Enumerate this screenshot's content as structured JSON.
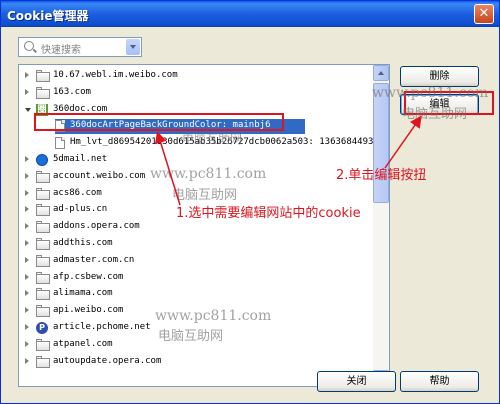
{
  "window": {
    "title": "Cookie管理器",
    "close_glyph": "✕"
  },
  "search": {
    "placeholder": "快速搜索"
  },
  "tree": {
    "items": [
      {
        "label": "10.67.webl.im.weibo.com",
        "level": 0,
        "icon": "folder-icon",
        "expanded": false
      },
      {
        "label": "163.com",
        "level": 0,
        "icon": "folder-icon",
        "expanded": false
      },
      {
        "label": "360doc.com",
        "level": 0,
        "icon": "360doc-favicon-icon",
        "expanded": true,
        "favicon_text": "圈"
      },
      {
        "label": "360docArtPageBackGroundColor: mainbj6",
        "level": 1,
        "icon": "file-icon",
        "selected": true
      },
      {
        "label": "Hm_lvt_d86954201130d615ab35b26727dcb0062a503: 1363684493",
        "level": 1,
        "icon": "file-icon"
      },
      {
        "label": "5dmail.net",
        "level": 0,
        "icon": "5dmail-favicon-icon",
        "expanded": false
      },
      {
        "label": "account.weibo.com",
        "level": 0,
        "icon": "folder-icon",
        "expanded": false
      },
      {
        "label": "acs86.com",
        "level": 0,
        "icon": "folder-icon",
        "expanded": false
      },
      {
        "label": "ad-plus.cn",
        "level": 0,
        "icon": "folder-icon",
        "expanded": false
      },
      {
        "label": "addons.opera.com",
        "level": 0,
        "icon": "folder-icon",
        "expanded": false
      },
      {
        "label": "addthis.com",
        "level": 0,
        "icon": "folder-icon",
        "expanded": false
      },
      {
        "label": "admaster.com.cn",
        "level": 0,
        "icon": "folder-icon",
        "expanded": false
      },
      {
        "label": "afp.csbew.com",
        "level": 0,
        "icon": "folder-icon",
        "expanded": false
      },
      {
        "label": "alimama.com",
        "level": 0,
        "icon": "folder-icon",
        "expanded": false
      },
      {
        "label": "api.weibo.com",
        "level": 0,
        "icon": "folder-icon",
        "expanded": false
      },
      {
        "label": "article.pchome.net",
        "level": 0,
        "icon": "pchome-favicon-icon",
        "expanded": false,
        "favicon_text": "P"
      },
      {
        "label": "atpanel.com",
        "level": 0,
        "icon": "folder-icon",
        "expanded": false
      },
      {
        "label": "autoupdate.opera.com",
        "level": 0,
        "icon": "folder-icon",
        "expanded": false
      }
    ]
  },
  "buttons": {
    "delete": "删除",
    "edit": "编辑",
    "close": "关闭",
    "help": "帮助"
  },
  "annotations": {
    "step1": "1.选中需要编辑网站中的cookie",
    "step2": "2.单击编辑按扭"
  },
  "watermarks": [
    {
      "text": "www.pc811.com",
      "name": "watermark-url-top"
    },
    {
      "text": "电脑互助网",
      "name": "watermark-cn-top"
    },
    {
      "text": "www.pc811.com",
      "name": "watermark-url-mid"
    },
    {
      "text": "电脑互助网",
      "name": "watermark-cn-mid"
    },
    {
      "text": "www.pc811.com",
      "name": "watermark-url-bottom"
    },
    {
      "text": "电脑互助网",
      "name": "watermark-cn-bottom"
    },
    {
      "text": "电脑互助网",
      "name": "watermark-cn-selected"
    }
  ],
  "colors": {
    "selection": "#316ac5",
    "annotation_red": "#e0141e",
    "titlebar": "#0a5ae8"
  }
}
